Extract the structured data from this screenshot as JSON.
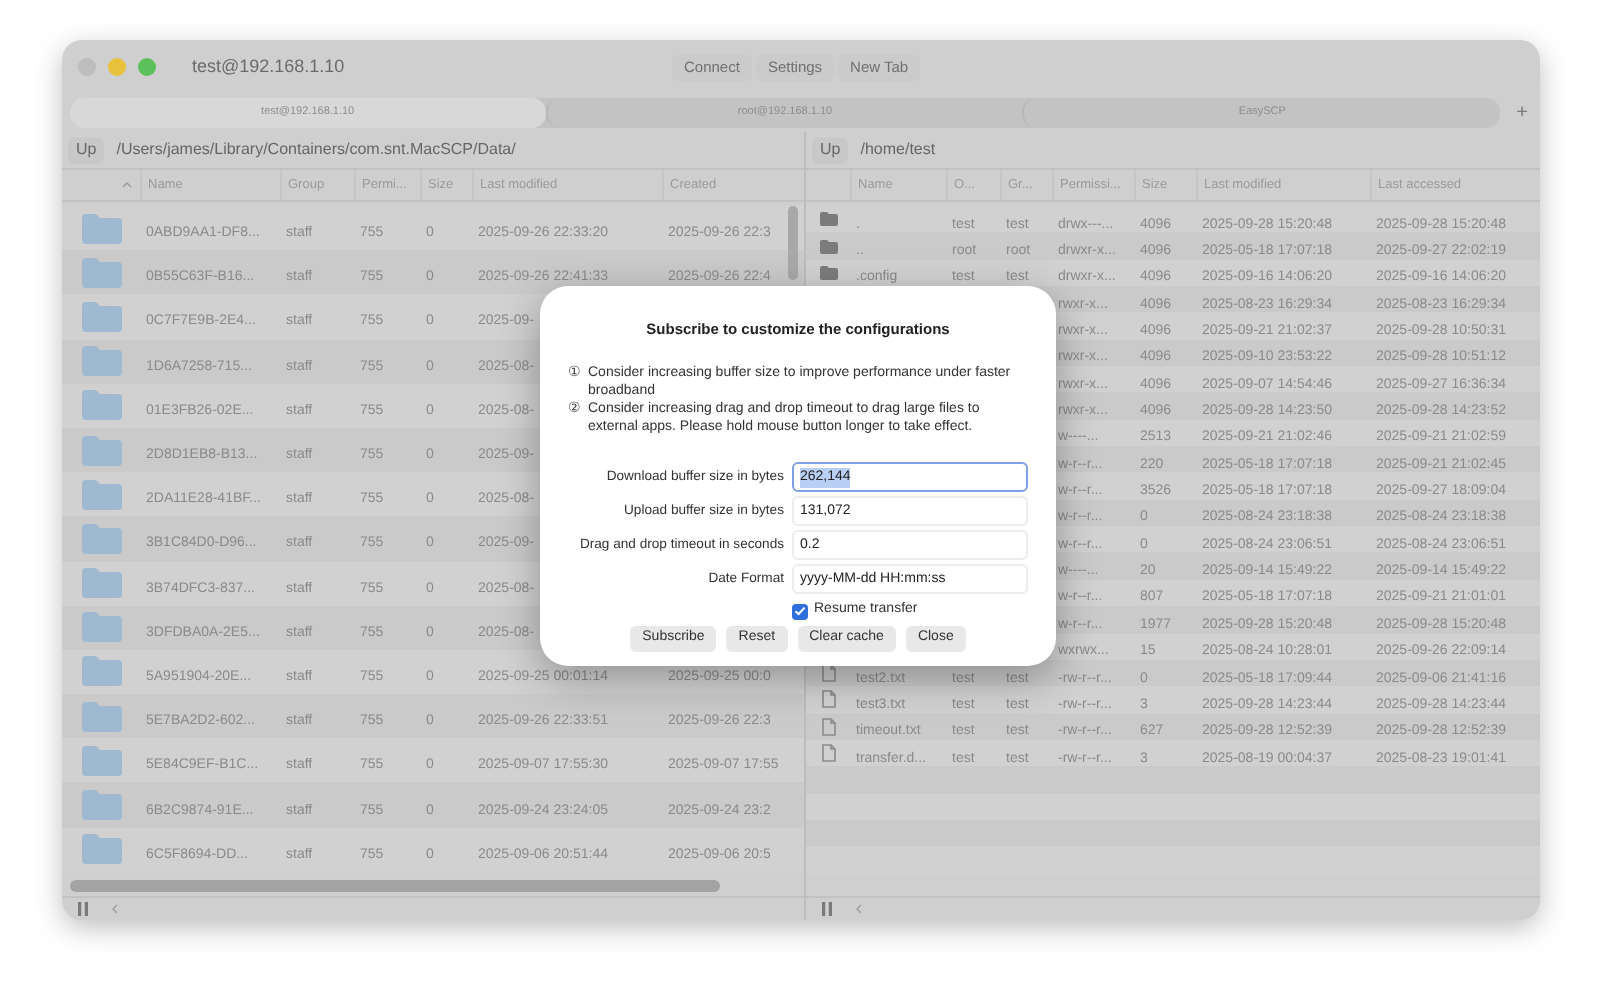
{
  "window": {
    "title": "test@192.168.1.10"
  },
  "toolbar": [
    "Connect",
    "Settings",
    "New Tab"
  ],
  "tabs": [
    {
      "label": "test@192.168.1.10",
      "selected": true
    },
    {
      "label": "root@192.168.1.10",
      "selected": false
    },
    {
      "label": "EasySCP",
      "selected": false
    }
  ],
  "new_tab_button": "+",
  "left_pane": {
    "up_button": "Up",
    "path": "/Users/james/Library/Containers/com.snt.MacSCP/Data/",
    "columns": [
      "Name",
      "Group",
      "Permi...",
      "Size",
      "Last modified",
      "Created"
    ],
    "rows": [
      {
        "kind": "folder",
        "name": "0ABD9AA1-DF8...",
        "group": "staff",
        "permissions": "755",
        "size": "0",
        "last_modified": "2025-09-26 22:33:20",
        "created": "2025-09-26 22:3"
      },
      {
        "kind": "folder",
        "name": "0B55C63F-B16...",
        "group": "staff",
        "permissions": "755",
        "size": "0",
        "last_modified": "2025-09-26 22:41:33",
        "created": "2025-09-26 22:4"
      },
      {
        "kind": "folder",
        "name": "0C7F7E9B-2E4...",
        "group": "staff",
        "permissions": "755",
        "size": "0",
        "last_modified": "2025-09-"
      },
      {
        "kind": "folder",
        "name": "1D6A7258-715...",
        "group": "staff",
        "permissions": "755",
        "size": "0",
        "last_modified": "2025-08-"
      },
      {
        "kind": "folder",
        "name": "01E3FB26-02E...",
        "group": "staff",
        "permissions": "755",
        "size": "0",
        "last_modified": "2025-08-"
      },
      {
        "kind": "folder",
        "name": "2D8D1EB8-B13...",
        "group": "staff",
        "permissions": "755",
        "size": "0",
        "last_modified": "2025-09-"
      },
      {
        "kind": "folder",
        "name": "2DA11E28-41BF...",
        "group": "staff",
        "permissions": "755",
        "size": "0",
        "last_modified": "2025-08-"
      },
      {
        "kind": "folder",
        "name": "3B1C84D0-D96...",
        "group": "staff",
        "permissions": "755",
        "size": "0",
        "last_modified": "2025-09-"
      },
      {
        "kind": "folder",
        "name": "3B74DFC3-837...",
        "group": "staff",
        "permissions": "755",
        "size": "0",
        "last_modified": "2025-08-"
      },
      {
        "kind": "folder",
        "name": "3DFDBA0A-2E5...",
        "group": "staff",
        "permissions": "755",
        "size": "0",
        "last_modified": "2025-08-"
      },
      {
        "kind": "folder",
        "name": "5A951904-20E...",
        "group": "staff",
        "permissions": "755",
        "size": "0",
        "last_modified": "2025-09-25 00:01:14",
        "created": "2025-09-25 00:0"
      },
      {
        "kind": "folder",
        "name": "5E7BA2D2-602...",
        "group": "staff",
        "permissions": "755",
        "size": "0",
        "last_modified": "2025-09-26 22:33:51",
        "created": "2025-09-26 22:3"
      },
      {
        "kind": "folder",
        "name": "5E84C9EF-B1C...",
        "group": "staff",
        "permissions": "755",
        "size": "0",
        "last_modified": "2025-09-07 17:55:30",
        "created": "2025-09-07 17:55"
      },
      {
        "kind": "folder",
        "name": "6B2C9874-91E...",
        "group": "staff",
        "permissions": "755",
        "size": "0",
        "last_modified": "2025-09-24 23:24:05",
        "created": "2025-09-24 23:2"
      },
      {
        "kind": "folder",
        "name": "6C5F8694-DD...",
        "group": "staff",
        "permissions": "755",
        "size": "0",
        "last_modified": "2025-09-06 20:51:44",
        "created": "2025-09-06 20:5"
      }
    ]
  },
  "right_pane": {
    "up_button": "Up",
    "path": "/home/test",
    "columns": [
      "Name",
      "O...",
      "Gr...",
      "Permissi...",
      "Size",
      "Last modified",
      "Last accessed"
    ],
    "rows": [
      {
        "kind": "folder",
        "name": ".",
        "owner": "test",
        "group": "test",
        "permissions": "drwx---...",
        "size": "4096",
        "last_modified": "2025-09-28 15:20:48",
        "last_accessed": "2025-09-28 15:20:48"
      },
      {
        "kind": "folder",
        "name": "..",
        "owner": "root",
        "group": "root",
        "permissions": "drwxr-x...",
        "size": "4096",
        "last_modified": "2025-05-18 17:07:18",
        "last_accessed": "2025-09-27 22:02:19"
      },
      {
        "kind": "folder",
        "name": ".config",
        "owner": "test",
        "group": "test",
        "permissions": "drwxr-x...",
        "size": "4096",
        "last_modified": "2025-09-16 14:06:20",
        "last_accessed": "2025-09-16 14:06:20"
      },
      {
        "permissions": "rwxr-x...",
        "size": "4096",
        "last_modified": "2025-08-23 16:29:34",
        "last_accessed": "2025-08-23 16:29:34"
      },
      {
        "permissions": "rwxr-x...",
        "size": "4096",
        "last_modified": "2025-09-21 21:02:37",
        "last_accessed": "2025-09-28 10:50:31"
      },
      {
        "permissions": "rwxr-x...",
        "size": "4096",
        "last_modified": "2025-09-10 23:53:22",
        "last_accessed": "2025-09-28 10:51:12"
      },
      {
        "permissions": "rwxr-x...",
        "size": "4096",
        "last_modified": "2025-09-07 14:54:46",
        "last_accessed": "2025-09-27 16:36:34"
      },
      {
        "permissions": "rwxr-x...",
        "size": "4096",
        "last_modified": "2025-09-28 14:23:50",
        "last_accessed": "2025-09-28 14:23:52"
      },
      {
        "permissions": "w----...",
        "size": "2513",
        "last_modified": "2025-09-21 21:02:46",
        "last_accessed": "2025-09-21 21:02:59"
      },
      {
        "permissions": "w-r--r...",
        "size": "220",
        "last_modified": "2025-05-18 17:07:18",
        "last_accessed": "2025-09-21 21:02:45"
      },
      {
        "permissions": "w-r--r...",
        "size": "3526",
        "last_modified": "2025-05-18 17:07:18",
        "last_accessed": "2025-09-27 18:09:04"
      },
      {
        "permissions": "w-r--r...",
        "size": "0",
        "last_modified": "2025-08-24 23:18:38",
        "last_accessed": "2025-08-24 23:18:38"
      },
      {
        "permissions": "w-r--r...",
        "size": "0",
        "last_modified": "2025-08-24 23:06:51",
        "last_accessed": "2025-08-24 23:06:51"
      },
      {
        "permissions": "w----...",
        "size": "20",
        "last_modified": "2025-09-14 15:49:22",
        "last_accessed": "2025-09-14 15:49:22"
      },
      {
        "permissions": "w-r--r...",
        "size": "807",
        "last_modified": "2025-05-18 17:07:18",
        "last_accessed": "2025-09-21 21:01:01"
      },
      {
        "permissions": "w-r--r...",
        "size": "1977",
        "last_modified": "2025-09-28 15:20:48",
        "last_accessed": "2025-09-28 15:20:48"
      },
      {
        "permissions": "wxrwx...",
        "size": "15",
        "last_modified": "2025-08-24 10:28:01",
        "last_accessed": "2025-09-26 22:09:14"
      },
      {
        "kind": "file",
        "name": "test2.txt",
        "owner": "test",
        "group": "test",
        "permissions": "-rw-r--r...",
        "size": "0",
        "last_modified": "2025-05-18 17:09:44",
        "last_accessed": "2025-09-06 21:41:16"
      },
      {
        "kind": "file",
        "name": "test3.txt",
        "owner": "test",
        "group": "test",
        "permissions": "-rw-r--r...",
        "size": "3",
        "last_modified": "2025-09-28 14:23:44",
        "last_accessed": "2025-09-28 14:23:44"
      },
      {
        "kind": "file",
        "name": "timeout.txt",
        "owner": "test",
        "group": "test",
        "permissions": "-rw-r--r...",
        "size": "627",
        "last_modified": "2025-09-28 12:52:39",
        "last_accessed": "2025-09-28 12:52:39"
      },
      {
        "kind": "file",
        "name": "transfer.d...",
        "owner": "test",
        "group": "test",
        "permissions": "-rw-r--r...",
        "size": "3",
        "last_modified": "2025-08-19 00:04:37",
        "last_accessed": "2025-08-23 19:01:41"
      }
    ]
  },
  "dialog": {
    "title": "Subscribe to customize the configurations",
    "notes": [
      {
        "marker": "①",
        "text": "Consider increasing buffer size to improve performance under faster broadband"
      },
      {
        "marker": "②",
        "text": "Consider increasing drag and drop timeout to drag large files to external apps. Please hold mouse button longer to take effect."
      }
    ],
    "fields": [
      {
        "label": "Download buffer size in bytes",
        "value": "262,144",
        "focused": true
      },
      {
        "label": "Upload buffer size in bytes",
        "value": "131,072",
        "focused": false
      },
      {
        "label": "Drag and drop timeout in seconds",
        "value": "0.2",
        "focused": false
      },
      {
        "label": "Date Format",
        "value": "yyyy-MM-dd HH:mm:ss",
        "focused": false
      }
    ],
    "checkbox": {
      "label": "Resume transfer",
      "checked": true
    },
    "buttons": [
      "Subscribe",
      "Reset",
      "Clear cache",
      "Close"
    ]
  }
}
